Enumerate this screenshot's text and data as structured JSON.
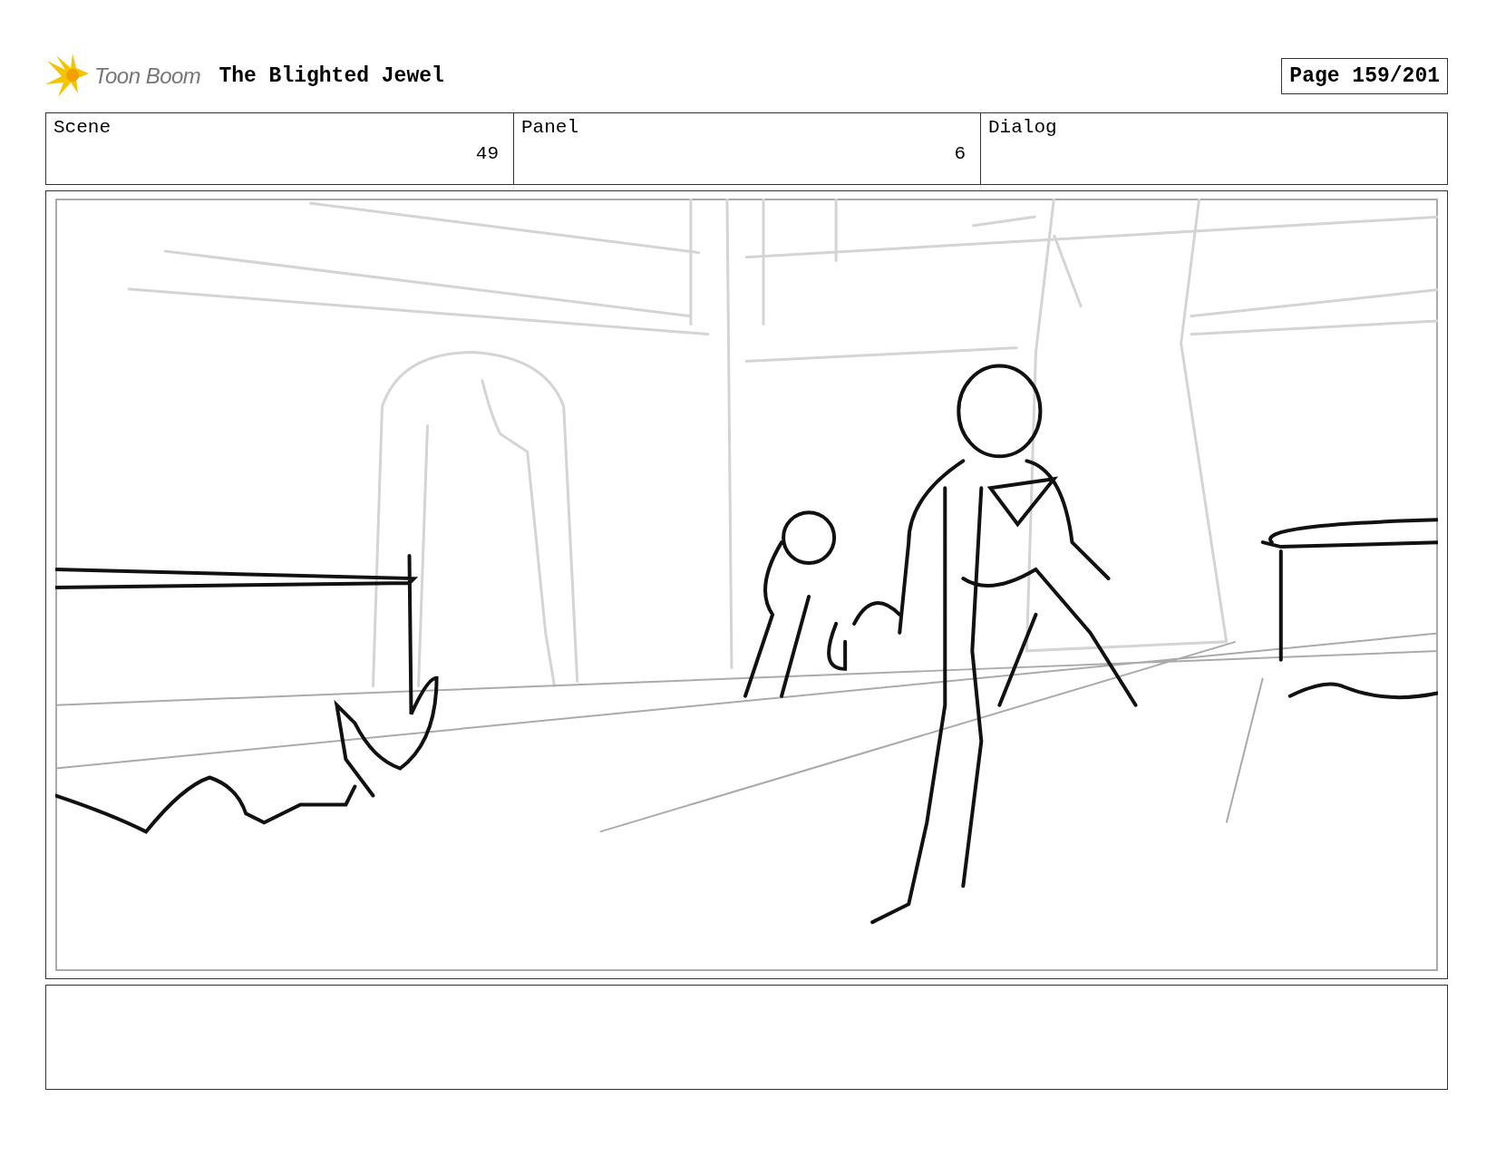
{
  "header": {
    "logo_text": "Toon Boom",
    "title": "The Blighted Jewel",
    "page": "Page 159/201"
  },
  "fields": [
    {
      "label": "Scene",
      "value": "49"
    },
    {
      "label": "Panel",
      "value": "6"
    },
    {
      "label": "Dialog"
    }
  ]
}
